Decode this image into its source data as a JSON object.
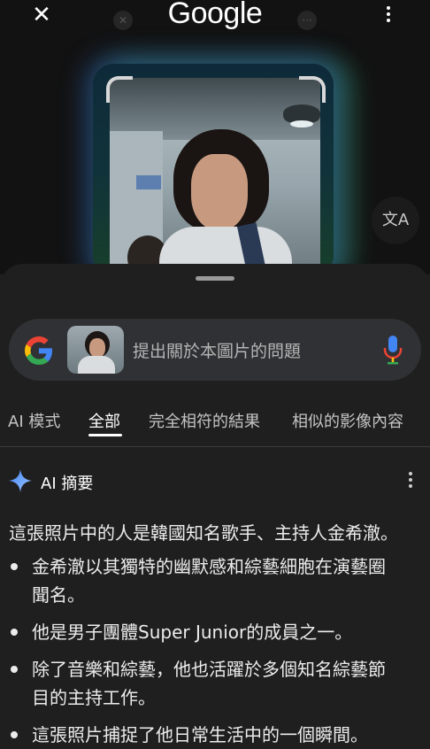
{
  "header": {
    "logo_text": "Google",
    "close_glyph": "✕",
    "ghost_close_glyph": "✕",
    "ghost_more_glyph": "···",
    "translate_glyph": "文A"
  },
  "search": {
    "placeholder": "提出關於本圖片的問題"
  },
  "tabs": [
    {
      "label": "AI 模式"
    },
    {
      "label": "全部"
    },
    {
      "label": "完全相符的結果"
    },
    {
      "label": "相似的影像內容"
    }
  ],
  "ai_overview": {
    "title": "AI 摘要",
    "summary": "這張照片中的人是韓國知名歌手、主持人金希澈。",
    "bullets": [
      {
        "line1": "金希澈以其獨特的幽默感和綜藝細胞在演藝圈",
        "line2": "聞名。"
      },
      {
        "line1": "他是男子團體Super Junior的成員之一。",
        "line2": ""
      },
      {
        "line1": "除了音樂和綜藝，他也活躍於多個知名綜藝節",
        "line2": "目的主持工作。"
      },
      {
        "line1": "這張照片捕捉了他日常生活中的一個瞬間。",
        "line2": ""
      }
    ]
  },
  "icons": [
    "close-icon",
    "more-vert-icon",
    "translate-icon",
    "google-g-icon",
    "mic-icon",
    "ai-sparkle-icon"
  ],
  "colors": {
    "background": "#1f1f1f",
    "search_bg": "#303134",
    "google_blue": "#4285F4",
    "google_red": "#EA4335",
    "google_yellow": "#FBBC05",
    "google_green": "#34A853"
  }
}
